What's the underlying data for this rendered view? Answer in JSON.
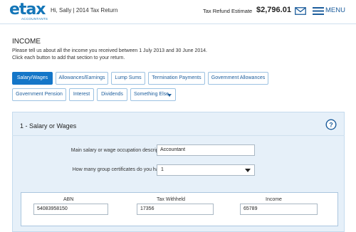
{
  "header": {
    "logo_text": "etax",
    "logo_subtext": "ACCOUNTANTS",
    "greeting": "Hi, Sally  |  2014 Tax Return",
    "refund_label": "Tax Refund Estimate",
    "refund_amount": "$2,796.01",
    "menu_label": "MENU"
  },
  "page": {
    "title": "INCOME",
    "intro_line1": "Please tell us about all the income you received between 1 July 2013 and 30 June 2014.",
    "intro_line2": "Click each button to add that section to your return."
  },
  "categories": {
    "salary": "Salary/Wages",
    "allowances": "Allowances/Earnings",
    "lump_sums": "Lump Sums",
    "termination": "Termination Payments",
    "gov_allowances": "Government Allowances",
    "gov_pension": "Government Pension",
    "interest": "Interest",
    "dividends": "Dividends",
    "something_else": "Something Else"
  },
  "salary_section": {
    "title": "1 - Salary or Wages",
    "occupation_label": "Main salary or wage occupation description",
    "occupation_value": "Accountant",
    "certificates_label": "How many group certificates do you have?",
    "certificates_value": "1",
    "columns": {
      "abn": "ABN",
      "tax_withheld": "Tax Withheld",
      "income": "Income"
    },
    "certificate_row": {
      "abn": "54083958150",
      "tax_withheld": "17356",
      "income": "65789"
    }
  },
  "colors": {
    "brand_blue": "#1476b8",
    "active_chip": "#1476c8",
    "panel_bg": "#e6f0f9"
  }
}
